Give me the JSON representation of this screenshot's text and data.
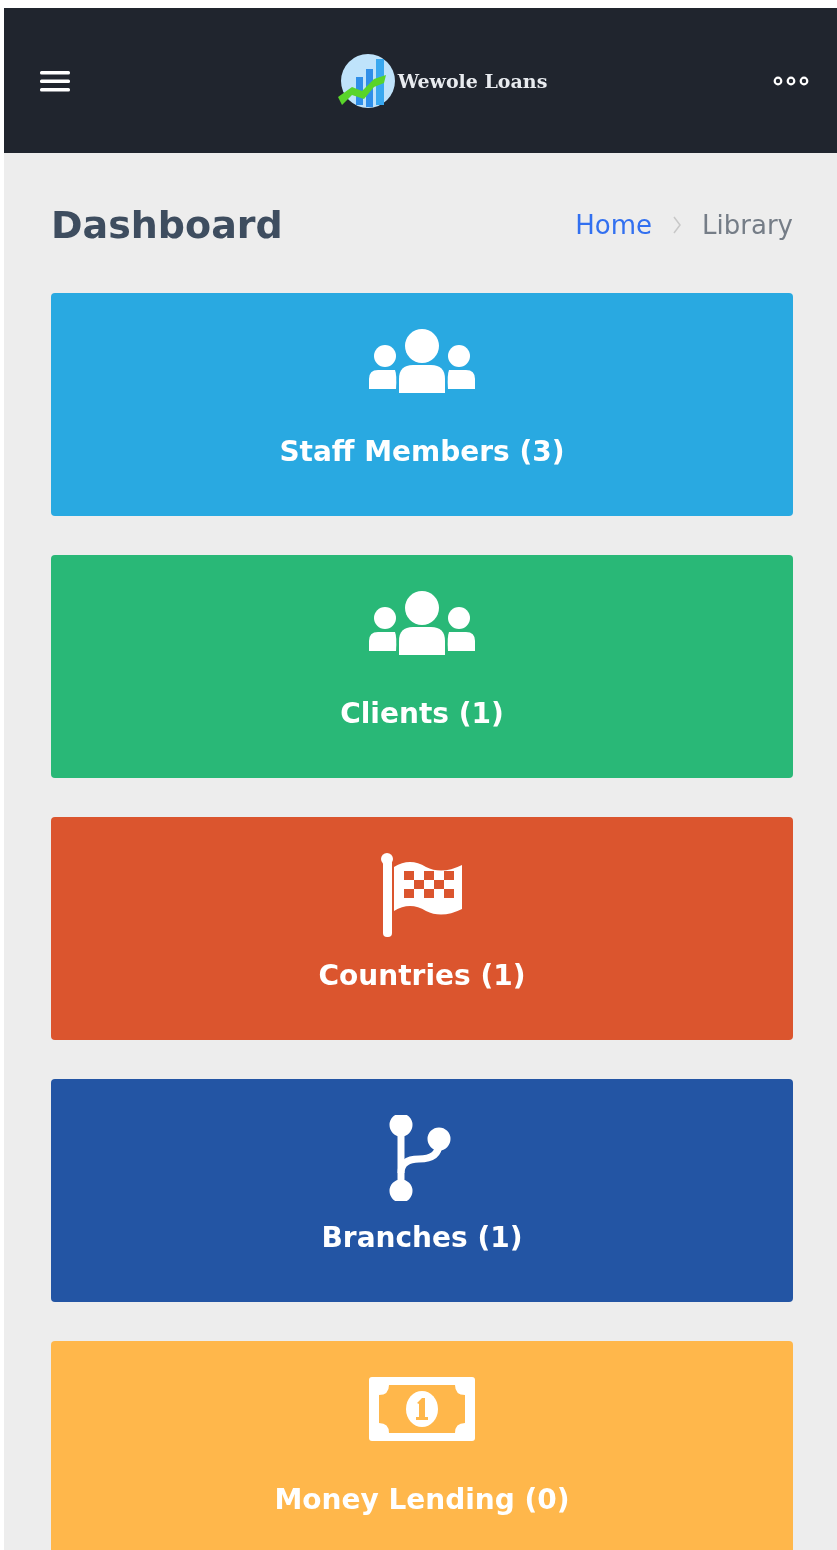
{
  "header": {
    "brand": "Wewole Loans"
  },
  "page": {
    "title": "Dashboard",
    "breadcrumb": [
      {
        "label": "Home",
        "kind": "link"
      },
      {
        "label": "Library",
        "kind": "current"
      }
    ]
  },
  "cards": [
    {
      "label": "Staff Members (3)",
      "kind": "users",
      "color": "#29a9e1"
    },
    {
      "label": "Clients (1)",
      "kind": "users",
      "color": "#29b877"
    },
    {
      "label": "Countries (1)",
      "kind": "flag",
      "color": "#db552e"
    },
    {
      "label": "Branches (1)",
      "kind": "branch",
      "color": "#2355a4"
    },
    {
      "label": "Money Lending (0)",
      "kind": "money",
      "color": "#ffb74b"
    }
  ]
}
